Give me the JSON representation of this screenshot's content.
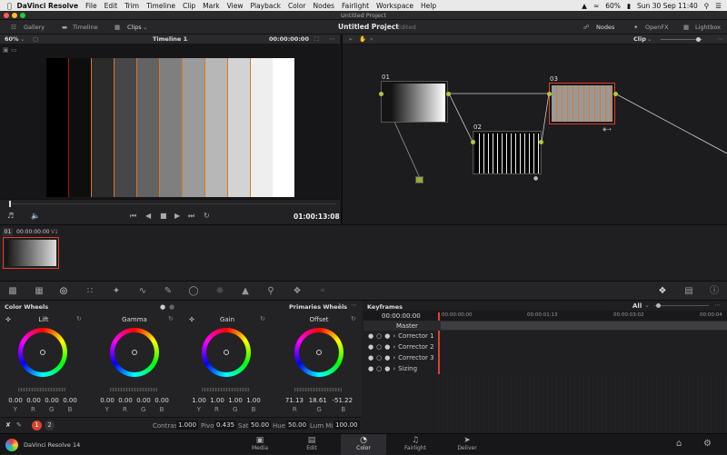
{
  "menubar": {
    "app": "DaVinci Resolve",
    "items": [
      "File",
      "Edit",
      "Trim",
      "Timeline",
      "Clip",
      "Mark",
      "View",
      "Playback",
      "Color",
      "Nodes",
      "Fairlight",
      "Workspace",
      "Help"
    ],
    "battery": "60%",
    "clock": "Sun 30 Sep  11:40"
  },
  "window": {
    "title": "Untitled Project"
  },
  "toolbar": {
    "gallery": "Gallery",
    "timeline": "Timeline",
    "clips": "Clips",
    "project": "Untitled Project",
    "edited": "Edited",
    "nodes": "Nodes",
    "openfx": "OpenFX",
    "lightbox": "Lightbox"
  },
  "viewer": {
    "zoom": "60%",
    "timeline_name": "Timeline 1",
    "timecode": "00:00:00:00",
    "current_tc": "01:00:13:08"
  },
  "nodes": {
    "mode": "Clip",
    "labels": [
      "01",
      "02",
      "03"
    ]
  },
  "timeline": {
    "clip_num": "01",
    "clip_tc": "00:00:00:00",
    "track": "V1"
  },
  "color_wheels": {
    "title": "Color Wheels",
    "mode": "Primaries Wheels",
    "wheels": [
      {
        "name": "Lift",
        "values": [
          "0.00",
          "0.00",
          "0.00",
          "0.00"
        ],
        "channels": [
          "Y",
          "R",
          "G",
          "B"
        ]
      },
      {
        "name": "Gamma",
        "values": [
          "0.00",
          "0.00",
          "0.00",
          "0.00"
        ],
        "channels": [
          "Y",
          "R",
          "G",
          "B"
        ]
      },
      {
        "name": "Gain",
        "values": [
          "1.00",
          "1.00",
          "1.00",
          "1.00"
        ],
        "channels": [
          "Y",
          "R",
          "G",
          "B"
        ]
      },
      {
        "name": "Offset",
        "values": [
          "71.13",
          "18.61",
          "-51.22"
        ],
        "channels": [
          "R",
          "G",
          "B"
        ]
      }
    ],
    "pages": [
      "1",
      "2"
    ],
    "params": [
      {
        "label": "Contrast",
        "value": "1.000"
      },
      {
        "label": "Pivot",
        "value": "0.435"
      },
      {
        "label": "Sat",
        "value": "50.00"
      },
      {
        "label": "Hue",
        "value": "50.00"
      },
      {
        "label": "Lum Mix",
        "value": "100.00"
      }
    ]
  },
  "keyframes": {
    "title": "Keyframes",
    "filter": "All",
    "current_tc": "00:00:00:00",
    "ruler": [
      "00:00:00:00",
      "00:00:01:13",
      "00:00:03:02",
      "00:00:04"
    ],
    "tracks": [
      "Master",
      "Corrector 1",
      "Corrector 2",
      "Corrector 3",
      "Sizing"
    ]
  },
  "bottom": {
    "app_name": "DaVinci Resolve 14",
    "tabs": [
      "Media",
      "Edit",
      "Color",
      "Fairlight",
      "Deliver"
    ],
    "active": "Color"
  },
  "colors": {
    "accent": "#e0402a",
    "node_link": "#b7c63a"
  }
}
